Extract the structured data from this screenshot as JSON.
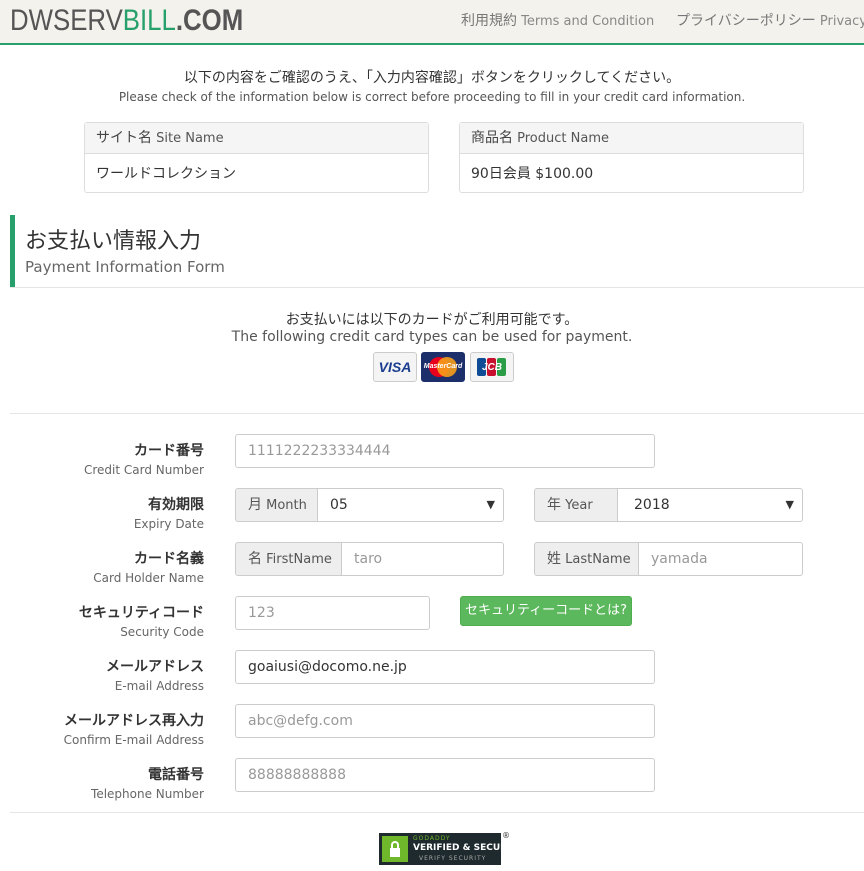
{
  "header": {
    "logo": {
      "part1": "DWSERV",
      "part2": "BILL",
      "part3": ".COM"
    },
    "nav": [
      {
        "jp": "利用規約",
        "en": "Terms and Condition"
      },
      {
        "jp": "プライバシーポリシー",
        "en": "Privacy"
      }
    ]
  },
  "intro": {
    "jp": "以下の内容をご確認のうえ、「入力内容確認」ボタンをクリックしてください。",
    "en": "Please check of the information below is correct before proceeding to fill in your credit card information."
  },
  "site_panel": {
    "label_jp": "サイト名",
    "label_en": "Site Name",
    "value": "ワールドコレクション"
  },
  "product_panel": {
    "label_jp": "商品名",
    "label_en": "Product Name",
    "value": "90日会員 $100.00"
  },
  "section": {
    "title_jp": "お支払い情報入力",
    "title_en": "Payment Information Form"
  },
  "cards_info": {
    "jp": "お支払いには以下のカードがご利用可能です。",
    "en": "The following credit card types can be used for payment.",
    "cards": [
      "VISA",
      "MasterCard",
      "JCB"
    ]
  },
  "form": {
    "card_number": {
      "label_jp": "カード番号",
      "label_en": "Credit Card Number",
      "placeholder": "1111222233334444"
    },
    "expiry": {
      "label_jp": "有効期限",
      "label_en": "Expiry Date",
      "month_addon_jp": "月",
      "month_addon_en": "Month",
      "month_value": "05",
      "year_addon_jp": "年",
      "year_addon_en": "Year",
      "year_value": "2018"
    },
    "holder": {
      "label_jp": "カード名義",
      "label_en": "Card Holder Name",
      "first_addon_jp": "名",
      "first_addon_en": "FirstName",
      "first_placeholder": "taro",
      "last_addon_jp": "姓",
      "last_addon_en": "LastName",
      "last_placeholder": "yamada"
    },
    "security": {
      "label_jp": "セキュリティコード",
      "label_en": "Security Code",
      "placeholder": "123",
      "help_button": "セキュリティーコードとは?"
    },
    "email": {
      "label_jp": "メールアドレス",
      "label_en": "E-mail Address",
      "value": "goaiusi@docomo.ne.jp"
    },
    "email_confirm": {
      "label_jp": "メールアドレス再入力",
      "label_en": "Confirm E-mail Address",
      "placeholder": "abc@defg.com"
    },
    "phone": {
      "label_jp": "電話番号",
      "label_en": "Telephone Number",
      "placeholder": "88888888888"
    }
  },
  "badge": {
    "line1": "GODADDY",
    "line2": "VERIFIED & SECURED",
    "line3": "VERIFY SECURITY",
    "reg": "®"
  },
  "colors": {
    "accent": "#27a06b",
    "button": "#5cb85c"
  }
}
